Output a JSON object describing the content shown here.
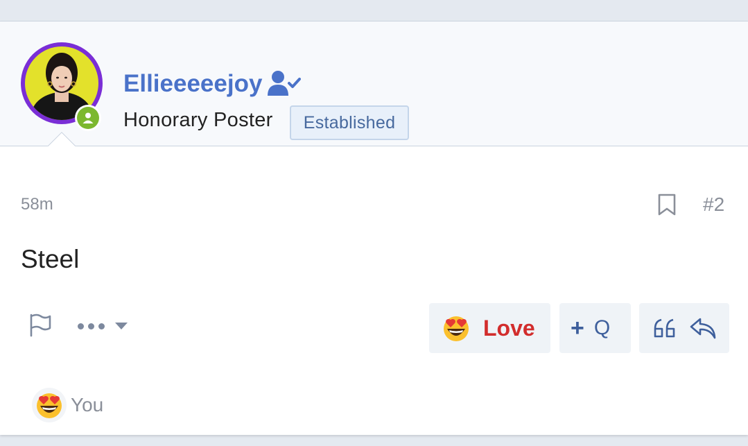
{
  "post": {
    "username": "Ellieeeeejoy",
    "user_title": "Honorary Poster",
    "user_badge": "Established",
    "timestamp": "58m",
    "post_number": "#2",
    "content": "Steel"
  },
  "actions": {
    "reaction_label": "Love",
    "multiquote_label": "Q"
  },
  "reactions": {
    "summary": "You"
  },
  "icons": {
    "verified": "user-check-icon",
    "bookmark": "bookmark-icon",
    "report": "flag-icon",
    "more": "more-dots-icon",
    "reaction": "heart-eyes-emoji",
    "quote": "quote-icon",
    "reply": "reply-icon",
    "online": "online-status-icon"
  },
  "colors": {
    "username": "#4a72c9",
    "love": "#d22d2d",
    "avatar_ring": "#7a2ed6",
    "online": "#7cb82f",
    "badge_bg": "#e8f0fa"
  }
}
